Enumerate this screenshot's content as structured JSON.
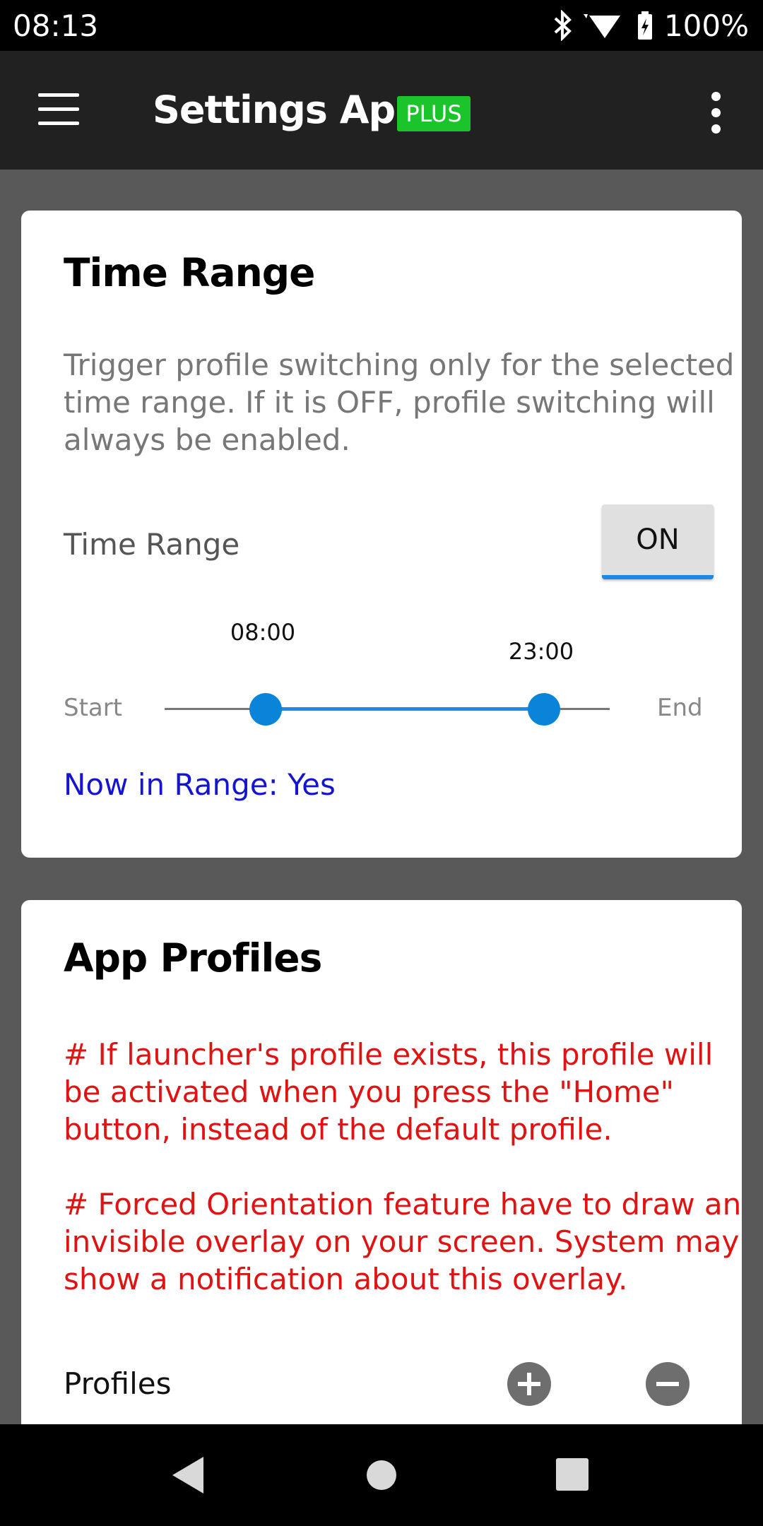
{
  "status_bar": {
    "time": "08:13",
    "battery": "100%"
  },
  "app_bar": {
    "title": "Settings App",
    "badge": "PLUS"
  },
  "time_range_card": {
    "title": "Time Range",
    "description": "Trigger profile switching only for the selected time range. If it is OFF, profile switching will always be enabled.",
    "toggle_label": "Time Range",
    "toggle_value": "ON",
    "slider": {
      "start_label": "Start",
      "end_label": "End",
      "start_value": "08:00",
      "end_value": "23:00"
    },
    "status": "Now in Range: Yes"
  },
  "app_profiles_card": {
    "title": "App Profiles",
    "note1": "# If launcher's profile exists, this profile will be activated when you press the \"Home\" button, instead of the default profile.",
    "note2": "# Forced Orientation feature have to draw an invisible overlay on your screen. System may show a notification about this overlay.",
    "profiles_label": "Profiles"
  },
  "colors": {
    "accent": "#1e88e5",
    "badge": "#1cc42c",
    "warning": "#e01313",
    "status_link": "#1515d0"
  }
}
